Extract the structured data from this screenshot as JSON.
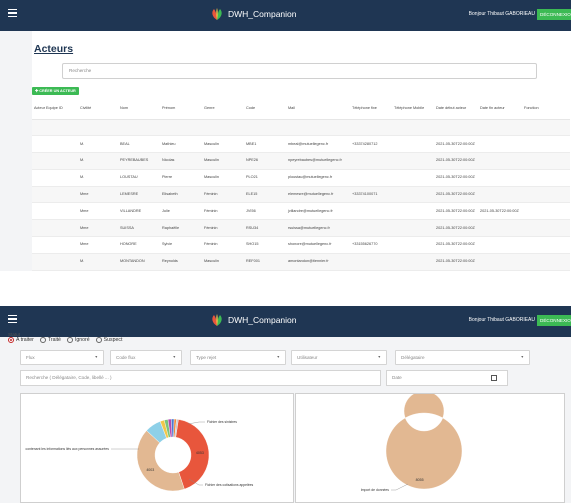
{
  "app": {
    "title": "DWH_Companion",
    "greeting": "Bonjour Thibaut GABORIEAU",
    "logout_label": "DÉCONNEXION"
  },
  "acteurs": {
    "page_title": "Acteurs",
    "search_placeholder": "Recherche",
    "create_button": "✚ CRÉER UN ACTEUR",
    "columns": [
      "Acteur Equipe ID",
      "Civilité",
      "Nom",
      "Prénom",
      "Genre",
      "Code",
      "Mail",
      "Téléphone fixe",
      "Téléphone Mobile",
      "Date début acteur",
      "Date fin acteur",
      "Fonction"
    ],
    "rows": [
      [
        "",
        "",
        "",
        "",
        "",
        "",
        "",
        "",
        "",
        "",
        "",
        ""
      ],
      [
        "",
        "M.",
        "BEAL",
        "Mathieu",
        "Masculin",
        "MBE1",
        "mbeal@mutuellegenc.fr",
        "+33374280712",
        "",
        "2021-05-30T22:00:00Z",
        "",
        ""
      ],
      [
        "",
        "M.",
        "PEYREBAUBES",
        "Nicolas",
        "Masculin",
        "NPE26",
        "npeyrebaubes@mutuellegenc.fr",
        "",
        "",
        "2021-05-30T22:00:00Z",
        "",
        ""
      ],
      [
        "",
        "M.",
        "LOUSTAU",
        "Pierre",
        "Masculin",
        "PLO21",
        "ploustau@mutuellegenc.fr",
        "",
        "",
        "2021-05-30T22:00:00Z",
        "",
        ""
      ],
      [
        "",
        "Mme",
        "LEMESRE",
        "Elisabeth",
        "Féminin",
        "ELE15",
        "elemesre@mutuellegenc.fr",
        "+33374100071",
        "",
        "2021-05-30T22:00:00Z",
        "",
        ""
      ],
      [
        "",
        "Mme",
        "VILLANDRE",
        "Julie",
        "Féminin",
        "JVI56",
        "jvillandre@mutuellegenc.fr",
        "",
        "",
        "2021-05-30T22:00:00Z",
        "2021-05-30T22:00:00Z",
        ""
      ],
      [
        "",
        "Mme",
        "SUISSA",
        "Raphaëlle",
        "Féminin",
        "RSU34",
        "rsuissa@mutuellegenc.fr",
        "",
        "",
        "2021-05-30T22:00:00Z",
        "",
        ""
      ],
      [
        "",
        "Mme",
        "HONORE",
        "Sylvie",
        "Féminin",
        "SHO15",
        "shonore@mutuellegenc.fr",
        "+33155626770",
        "",
        "2021-05-30T22:00:00Z",
        "",
        ""
      ],
      [
        "",
        "M.",
        "MONTANDON",
        "Reynolds",
        "Masculin",
        "REF001",
        "amontandon@tiennier.fr",
        "",
        "",
        "2021-05-30T22:00:00Z",
        "",
        ""
      ],
      [
        "",
        "Mme",
        "CASTELAIN",
        "Brigitte",
        "Féminin",
        "BCA44",
        "bcastelain@mutuellegenc.fr",
        "+33374260714",
        "",
        "2021-05-30T22:00:00Z",
        "",
        ""
      ]
    ]
  },
  "rejets": {
    "statut_label": "Statut",
    "radios": [
      {
        "label": "A traiter",
        "checked": true
      },
      {
        "label": "Traité",
        "checked": false
      },
      {
        "label": "Ignoré",
        "checked": false
      },
      {
        "label": "Suspect",
        "checked": false
      }
    ],
    "filters": [
      "Flux",
      "Code flux",
      "Type rejet",
      "Utilisateur",
      "Délégataire"
    ],
    "search_placeholder": "Recherche ( Délégataire, Code, libellé ... )",
    "date_placeholder": "Date"
  },
  "chart_data": [
    {
      "type": "pie",
      "donut": true,
      "labels": [
        "contenant les informations liés aux personnes assurées",
        "Fichier des cotisations appelées",
        "Fichier des sinistres",
        "",
        "",
        "",
        "",
        "",
        ""
      ],
      "values": [
        4053,
        4003,
        700,
        180,
        160,
        140,
        120,
        100,
        80
      ],
      "value_labels": [
        "4053",
        "4003",
        "",
        "",
        "",
        "",
        "",
        "",
        ""
      ],
      "colors": [
        "#e8563c",
        "#e2b892",
        "#8ed0e8",
        "#f2c74a",
        "#7cc47b",
        "#b64ab0",
        "#4a7bd0",
        "#f08a3c",
        "#c9c9c9"
      ]
    },
    {
      "type": "pie",
      "donut": true,
      "labels": [
        "Import de données"
      ],
      "values": [
        8055
      ],
      "value_labels": [
        "8055"
      ],
      "colors": [
        "#e2b892"
      ]
    }
  ]
}
